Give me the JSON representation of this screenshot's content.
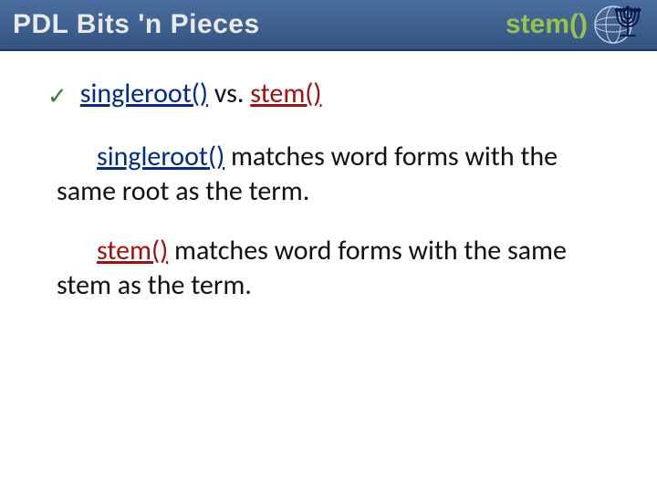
{
  "header": {
    "title": "PDL Bits 'n Pieces",
    "func": "stem()"
  },
  "bullet": {
    "func_singleroot": "singleroot()",
    "vs": " vs. ",
    "func_stem": "stem()"
  },
  "para1": {
    "lead": "singleroot()",
    "rest": " matches word forms with the same root as the term."
  },
  "para2": {
    "lead": "stem()",
    "rest": " matches word forms with the same stem as the term."
  },
  "colors": {
    "header_grad_top": "#4a6ea0",
    "header_grad_bot": "#33547f",
    "accent_green": "#99c24d",
    "check_green": "#2e7d32",
    "singleroot_blue": "#002b8b",
    "stem_red": "#a11010"
  }
}
